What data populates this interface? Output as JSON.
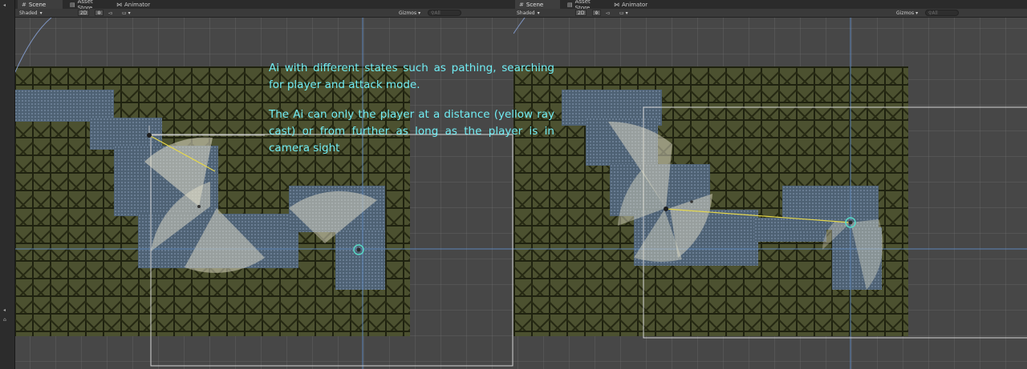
{
  "window": {
    "tabs": [
      {
        "label": "Scene",
        "icon": "scene-icon",
        "active": true
      },
      {
        "label": "Asset Store",
        "icon": "asset-store-icon",
        "active": false
      },
      {
        "label": "Animator",
        "icon": "animator-icon",
        "active": false
      }
    ]
  },
  "toolbar": {
    "draw_mode": "Shaded",
    "mode_2d": "2D",
    "gizmos": "Gizmos",
    "search_placeholder": "All"
  },
  "annotation": {
    "paragraph1": "Ai with different states such as pathing, searching for player and attack mode.",
    "paragraph2": "The Ai can only the player at a distance (yellow ray cast) or from further as long as the player is in camera sight"
  },
  "colors": {
    "annotation_text": "#70ecf3",
    "tile_wall": "#4c5130",
    "floor_water": "#4e6174",
    "ray_cast": "#e6d84a",
    "vision_cone": "#d8d2b8"
  }
}
